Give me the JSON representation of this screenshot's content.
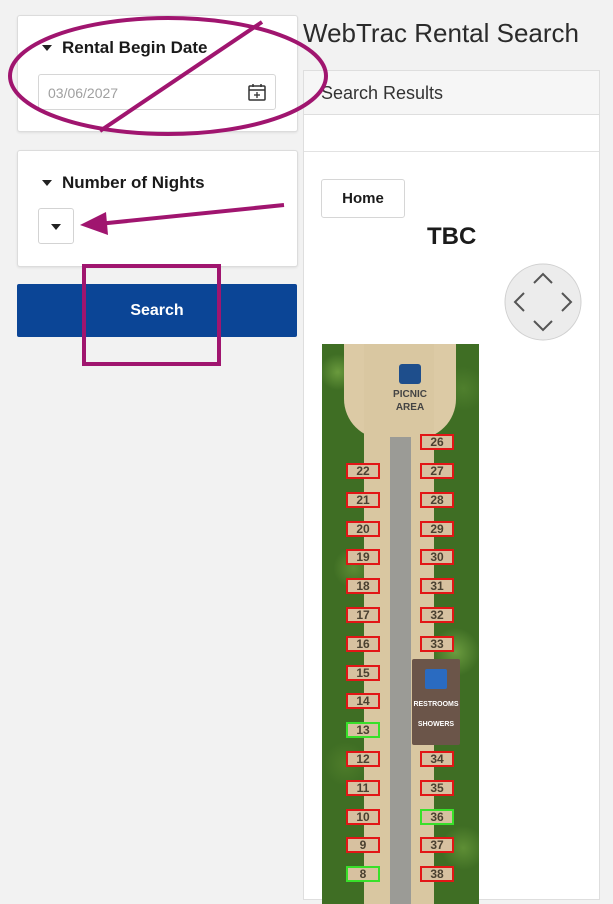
{
  "sidebar": {
    "begin_date": {
      "title": "Rental Begin Date",
      "value": "03/06/2027"
    },
    "nights": {
      "title": "Number of Nights"
    },
    "search_label": "Search"
  },
  "page_title": "WebTrac Rental Search",
  "results": {
    "header": "Search Results",
    "home_label": "Home",
    "title": "TBC"
  },
  "map": {
    "picnic_line1": "PICNIC",
    "picnic_line2": "AREA",
    "restrooms": "RESTROOMS",
    "showers": "SHOWERS",
    "left_sites": [
      {
        "label": "22",
        "status": "unavailable"
      },
      {
        "label": "21",
        "status": "unavailable"
      },
      {
        "label": "20",
        "status": "unavailable"
      },
      {
        "label": "19",
        "status": "unavailable"
      },
      {
        "label": "18",
        "status": "unavailable"
      },
      {
        "label": "17",
        "status": "unavailable"
      },
      {
        "label": "16",
        "status": "unavailable"
      },
      {
        "label": "15",
        "status": "unavailable"
      },
      {
        "label": "14",
        "status": "unavailable"
      },
      {
        "label": "13",
        "status": "available"
      },
      {
        "label": "12",
        "status": "unavailable"
      },
      {
        "label": "11",
        "status": "unavailable"
      },
      {
        "label": "10",
        "status": "unavailable"
      },
      {
        "label": "9",
        "status": "unavailable"
      },
      {
        "label": "8",
        "status": "available"
      }
    ],
    "right_sites": [
      {
        "label": "26",
        "status": "unavailable",
        "row": 0
      },
      {
        "label": "27",
        "status": "unavailable",
        "row": 1
      },
      {
        "label": "28",
        "status": "unavailable",
        "row": 2
      },
      {
        "label": "29",
        "status": "unavailable",
        "row": 3
      },
      {
        "label": "30",
        "status": "unavailable",
        "row": 4
      },
      {
        "label": "31",
        "status": "unavailable",
        "row": 5
      },
      {
        "label": "32",
        "status": "unavailable",
        "row": 6
      },
      {
        "label": "33",
        "status": "unavailable",
        "row": 7
      },
      {
        "label": "34",
        "status": "unavailable",
        "row": 11
      },
      {
        "label": "35",
        "status": "unavailable",
        "row": 12
      },
      {
        "label": "36",
        "status": "available",
        "row": 13
      },
      {
        "label": "37",
        "status": "unavailable",
        "row": 14
      },
      {
        "label": "38",
        "status": "unavailable",
        "row": 15
      }
    ]
  },
  "colors": {
    "primary": "#0b4596",
    "annotation": "#a0156f",
    "unavailable": "#e21616",
    "available": "#38e02a"
  }
}
